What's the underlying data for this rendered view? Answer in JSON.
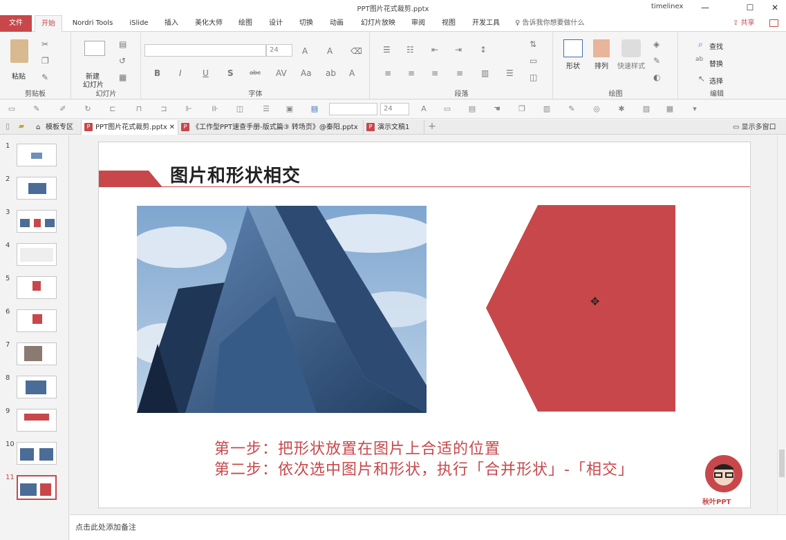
{
  "window": {
    "title": "PPT图片花式裁剪.pptx",
    "user": "timelinex",
    "minimize": "—",
    "maximize": "☐",
    "close": "✕"
  },
  "ribbon_tabs": {
    "file": "文件",
    "tabs": [
      "开始",
      "Nordri Tools",
      "iSlide",
      "插入",
      "美化大师",
      "绘图",
      "设计",
      "切换",
      "动画",
      "幻灯片放映",
      "审阅",
      "视图",
      "开发工具"
    ],
    "active": "开始",
    "tell_me": "告诉我你想要做什么",
    "share": "共享"
  },
  "ribbon": {
    "clipboard": {
      "label": "剪贴板",
      "paste": "粘贴"
    },
    "slides": {
      "label": "幻灯片",
      "new_slide_1": "新建",
      "new_slide_2": "幻灯片"
    },
    "font": {
      "label": "字体",
      "size": "24",
      "bold": "B",
      "italic": "I",
      "underline": "U",
      "shadow": "S",
      "strike": "abc"
    },
    "paragraph": {
      "label": "段落"
    },
    "drawing": {
      "label": "绘图",
      "shapes": "形状",
      "arrange": "排列",
      "quick_styles": "快速样式"
    },
    "editing": {
      "label": "编辑",
      "find": "查找",
      "replace": "替换",
      "select": "选择"
    }
  },
  "quick_toolbar": {
    "font_size": "24"
  },
  "doc_tabs": [
    {
      "label": "模板专区",
      "active": false
    },
    {
      "label": "PPT图片花式裁剪.pptx",
      "active": true
    },
    {
      "label": "《工作型PPT速查手册-版式篇③ 转场页》@秦阳.pptx",
      "active": false
    },
    {
      "label": "演示文稿1",
      "active": false
    }
  ],
  "show_multi_window": "显示多窗口",
  "slides_panel": {
    "numbers": [
      "1",
      "2",
      "3",
      "4",
      "5",
      "6",
      "7",
      "8",
      "9",
      "10",
      "11"
    ],
    "selected": "11"
  },
  "slide": {
    "title": "图片和形状相交",
    "step1": "第一步：把形状放置在图片上合适的位置",
    "step2": "第二步：依次选中图片和形状，执行「合并形状」-「相交」",
    "logo_text": "秋叶PPT",
    "accent_color": "#c8474a"
  },
  "notes_placeholder": "点击此处添加备注"
}
